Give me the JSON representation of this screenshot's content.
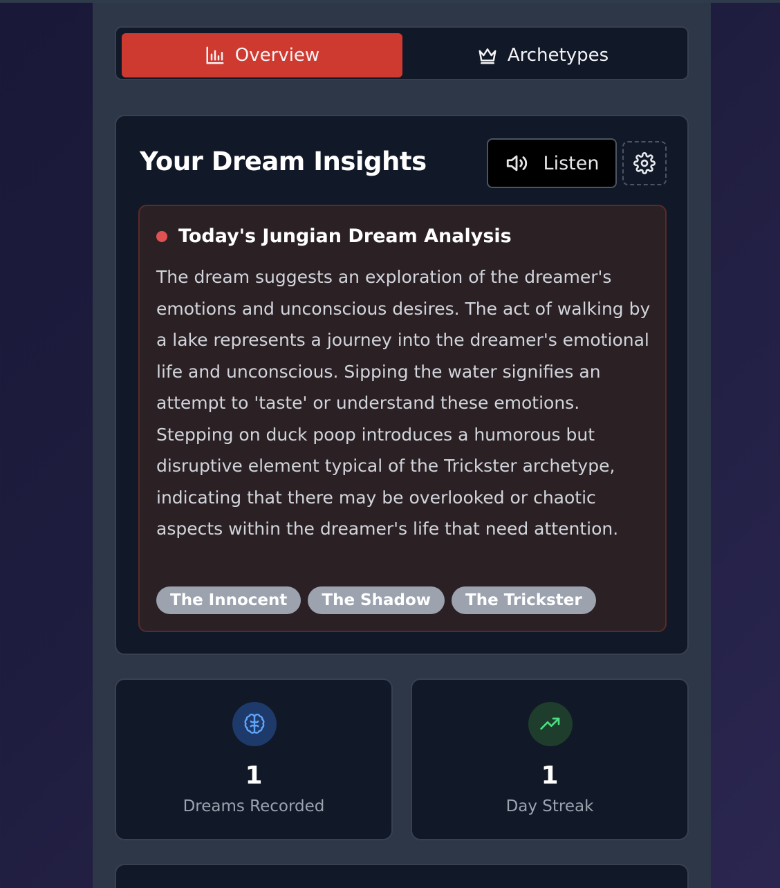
{
  "tabs": {
    "overview": {
      "label": "Overview",
      "icon": "bar-chart-icon",
      "active": true
    },
    "archetypes": {
      "label": "Archetypes",
      "icon": "crown-icon",
      "active": false
    }
  },
  "insights": {
    "title": "Your Dream Insights",
    "listen_label": "Listen",
    "listen_icon": "speaker-icon",
    "settings_icon": "gear-icon",
    "analysis": {
      "title": "Today's Jungian Dream Analysis",
      "text": "The dream suggests an exploration of the dreamer's emotions and unconscious desires. The act of walking by a lake represents a journey into the dreamer's emotional life and unconscious. Sipping the water signifies an attempt to 'taste' or understand these emotions. Stepping on duck poop introduces a humorous but disruptive element typical of the Trickster archetype, indicating that there may be overlooked or chaotic aspects within the dreamer's life that need attention.",
      "tags": [
        "The Innocent",
        "The Shadow",
        "The Trickster"
      ]
    }
  },
  "stats": [
    {
      "value": "1",
      "label": "Dreams Recorded",
      "icon": "brain-icon",
      "icon_color": "#60a5fa",
      "icon_bg": "#1e3a6b"
    },
    {
      "value": "1",
      "label": "Day Streak",
      "icon": "trending-up-icon",
      "icon_color": "#4ade80",
      "icon_bg": "#1f3d2c"
    }
  ],
  "colors": {
    "accent": "#cf3a30",
    "card_bg": "#111827",
    "page_column": "#2d3748"
  }
}
